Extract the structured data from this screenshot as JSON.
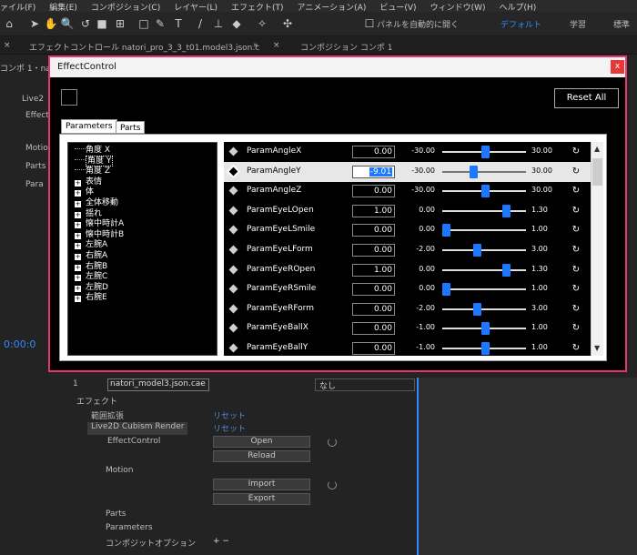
{
  "menu": [
    "ァイル(F)",
    "編集(E)",
    "コンポジション(C)",
    "レイヤー(L)",
    "エフェクト(T)",
    "アニメーション(A)",
    "ビュー(V)",
    "ウィンドウ(W)",
    "ヘルプ(H)"
  ],
  "toolbar": {
    "auto_open": "パネルを自動的に開く",
    "workspace_default": "デフォルト",
    "workspace_learn": "学習",
    "workspace_standard": "標準"
  },
  "tabs": {
    "effect_control": "エフェクトコントロール natori_pro_3_3_t01.model3.json.c",
    "composition": "コンポジション コンポ 1"
  },
  "left_panel": {
    "row1": "コンポ 1・nat",
    "row2": "Live2",
    "row3": "Effect",
    "row4": "Motio",
    "row5": "Parts",
    "row6": "Para"
  },
  "dialog": {
    "title": "EffectControl",
    "close": "x",
    "reset_all": "Reset All",
    "tab_parameters": "Parameters",
    "tab_parts": "Parts",
    "tree": [
      "角度 X",
      "角度 Y",
      "角度 Z",
      "表情",
      "体",
      "全体移動",
      "揺れ",
      "懐中時計A",
      "懐中時計B",
      "左腕A",
      "右腕A",
      "右腕B",
      "左腕C",
      "左腕D",
      "右腕E"
    ],
    "params": [
      {
        "name": "ParamAngleX",
        "value": "0.00",
        "min": "-30.00",
        "max": "30.00",
        "pos": 0.5
      },
      {
        "name": "ParamAngleY",
        "value": "-9.01",
        "min": "-30.00",
        "max": "30.00",
        "pos": 0.35
      },
      {
        "name": "ParamAngleZ",
        "value": "0.00",
        "min": "-30.00",
        "max": "30.00",
        "pos": 0.5
      },
      {
        "name": "ParamEyeLOpen",
        "value": "1.00",
        "min": "0.00",
        "max": "1.30",
        "pos": 0.77
      },
      {
        "name": "ParamEyeLSmile",
        "value": "0.00",
        "min": "0.00",
        "max": "1.00",
        "pos": 0.0
      },
      {
        "name": "ParamEyeLForm",
        "value": "0.00",
        "min": "-2.00",
        "max": "3.00",
        "pos": 0.4
      },
      {
        "name": "ParamEyeROpen",
        "value": "1.00",
        "min": "0.00",
        "max": "1.30",
        "pos": 0.77
      },
      {
        "name": "ParamEyeRSmile",
        "value": "0.00",
        "min": "0.00",
        "max": "1.00",
        "pos": 0.0
      },
      {
        "name": "ParamEyeRForm",
        "value": "0.00",
        "min": "-2.00",
        "max": "3.00",
        "pos": 0.4
      },
      {
        "name": "ParamEyeBallX",
        "value": "0.00",
        "min": "-1.00",
        "max": "1.00",
        "pos": 0.5
      },
      {
        "name": "ParamEyeBallY",
        "value": "0.00",
        "min": "-1.00",
        "max": "1.00",
        "pos": 0.5
      }
    ]
  },
  "timeline": {
    "time": "0:00:0",
    "layer_name": "natori_model3.json.cae",
    "none": "なし",
    "effect": "エフェクト",
    "range": "範囲拡張",
    "reset": "リセット",
    "renderer": "Live2D Cubism Render",
    "effect_control": "EffectControl",
    "open": "Open",
    "reload": "Reload",
    "motion": "Motion",
    "import": "Import",
    "export": "Export",
    "parts": "Parts",
    "parameters": "Parameters",
    "composite": "コンポジットオプション",
    "plusminus": "+ −",
    "layer_index": "1"
  }
}
